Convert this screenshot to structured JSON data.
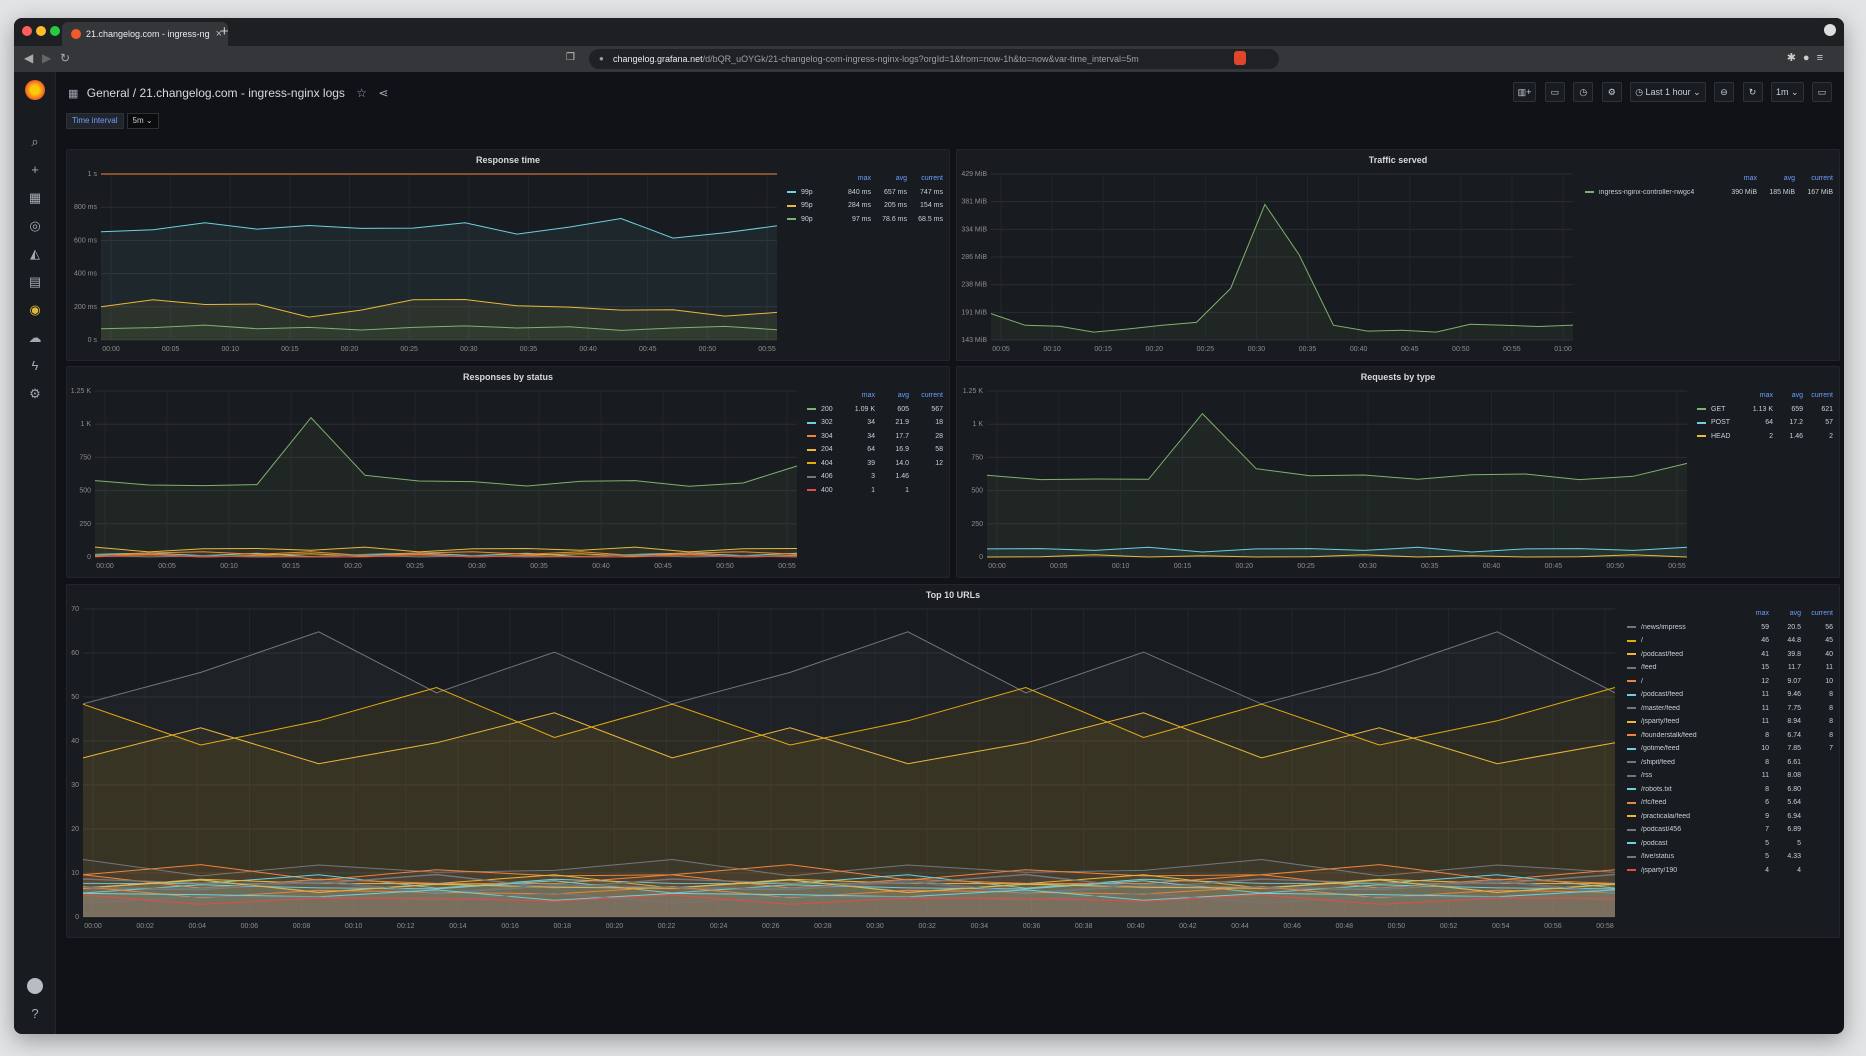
{
  "browser": {
    "tab_title": "21.changelog.com - ingress-ng",
    "url_host": "changelog.grafana.net",
    "url_path": "/d/bQR_uOYGk/21-changelog-com-ingress-nginx-logs?orgId=1&from=now-1h&to=now&var-time_interval=5m"
  },
  "header": {
    "folder": "General",
    "separator": "/",
    "dashboard_title": "21.changelog.com - ingress-nginx logs",
    "time_range": "Last 1 hour",
    "refresh": "1m"
  },
  "variables": {
    "label": "Time interval",
    "value": "5m"
  },
  "colors": {
    "green": "#7eb26d",
    "yellow": "#eab839",
    "blue": "#6ed0e0",
    "orange": "#ef843c",
    "red": "#e24d42",
    "gray": "#73777d",
    "sand": "#e5ac0e"
  },
  "legend_headers": {
    "max": "max",
    "avg": "avg",
    "current": "current"
  },
  "panels": {
    "response_time": {
      "title": "Response time",
      "chart_data": {
        "type": "line",
        "x": [
          "00:00",
          "00:05",
          "00:10",
          "00:15",
          "00:20",
          "00:25",
          "00:30",
          "00:35",
          "00:40",
          "00:45",
          "00:50",
          "00:55"
        ],
        "y_ticks": [
          "0 s",
          "200 ms",
          "400 ms",
          "600 ms",
          "800 ms",
          "1 s"
        ],
        "ylim": [
          0,
          1000
        ],
        "threshold": 1000,
        "series": [
          {
            "name": "99p",
            "color": "blue",
            "max": "840 ms",
            "avg": "657 ms",
            "current": "747 ms",
            "values": [
              640,
              670,
              700,
              680,
              690,
              660,
              680,
              700,
              650,
              680,
              720,
              620,
              640,
              700
            ]
          },
          {
            "name": "95p",
            "color": "yellow",
            "max": "284 ms",
            "avg": "205 ms",
            "current": "154 ms",
            "values": [
              200,
              230,
              220,
              210,
              150,
              180,
              230,
              250,
              200,
              210,
              180,
              170,
              150,
              160
            ]
          },
          {
            "name": "90p",
            "color": "green",
            "max": "97 ms",
            "avg": "78.6 ms",
            "current": "68.5 ms",
            "values": [
              80,
              75,
              78,
              74,
              70,
              72,
              76,
              73,
              78,
              74,
              70,
              72,
              70,
              68
            ]
          }
        ]
      }
    },
    "traffic_served": {
      "title": "Traffic served",
      "chart_data": {
        "type": "line",
        "x": [
          "00:05",
          "00:10",
          "00:15",
          "00:20",
          "00:25",
          "00:30",
          "00:35",
          "00:40",
          "00:45",
          "00:50",
          "00:55",
          "01:00"
        ],
        "y_ticks": [
          "143 MiB",
          "191 MiB",
          "238 MiB",
          "286 MiB",
          "334 MiB",
          "381 MiB",
          "429 MiB"
        ],
        "ylim": [
          143,
          429
        ],
        "series": [
          {
            "name": "ingress-nginx-controller-nwgc4",
            "color": "green",
            "max": "390 MiB",
            "avg": "185 MiB",
            "current": "167 MiB",
            "values": [
              185,
              170,
              165,
              160,
              162,
              165,
              175,
              230,
              380,
              290,
              165,
              160,
              158,
              160,
              170,
              165,
              168,
              167
            ]
          }
        ]
      }
    },
    "responses_by_status": {
      "title": "Responses by status",
      "chart_data": {
        "type": "line",
        "x": [
          "00:00",
          "00:05",
          "00:10",
          "00:15",
          "00:20",
          "00:25",
          "00:30",
          "00:35",
          "00:40",
          "00:45",
          "00:50",
          "00:55"
        ],
        "y_ticks": [
          "0",
          "250",
          "500",
          "750",
          "1 K",
          "1.25 K"
        ],
        "ylim": [
          0,
          1250
        ],
        "series": [
          {
            "name": "200",
            "color": "green",
            "max": "1.09 K",
            "avg": "605",
            "current": "567",
            "values": [
              560,
              550,
              530,
              560,
              1050,
              600,
              580,
              560,
              550,
              570,
              560,
              540,
              550,
              700
            ]
          },
          {
            "name": "302",
            "color": "blue",
            "max": "34",
            "avg": "21.9",
            "current": "18"
          },
          {
            "name": "304",
            "color": "orange",
            "max": "34",
            "avg": "17.7",
            "current": "28"
          },
          {
            "name": "204",
            "color": "yellow",
            "max": "64",
            "avg": "16.9",
            "current": "58"
          },
          {
            "name": "404",
            "color": "sand",
            "max": "39",
            "avg": "14.0",
            "current": "12"
          },
          {
            "name": "406",
            "color": "gray",
            "max": "3",
            "avg": "1.46",
            "current": ""
          },
          {
            "name": "400",
            "color": "red",
            "max": "1",
            "avg": "1",
            "current": ""
          }
        ]
      }
    },
    "requests_by_type": {
      "title": "Requests by type",
      "chart_data": {
        "type": "line",
        "x": [
          "00:00",
          "00:05",
          "00:10",
          "00:15",
          "00:20",
          "00:25",
          "00:30",
          "00:35",
          "00:40",
          "00:45",
          "00:50",
          "00:55"
        ],
        "y_ticks": [
          "0",
          "250",
          "500",
          "750",
          "1 K",
          "1.25 K"
        ],
        "ylim": [
          0,
          1250
        ],
        "series": [
          {
            "name": "GET",
            "color": "green",
            "max": "1.13 K",
            "avg": "659",
            "current": "621",
            "values": [
              600,
              590,
              580,
              600,
              1080,
              650,
              620,
              610,
              600,
              620,
              610,
              590,
              600,
              720
            ]
          },
          {
            "name": "POST",
            "color": "blue",
            "max": "64",
            "avg": "17.2",
            "current": "57"
          },
          {
            "name": "HEAD",
            "color": "yellow",
            "max": "2",
            "avg": "1.46",
            "current": "2"
          }
        ]
      }
    },
    "top_urls": {
      "title": "Top 10 URLs",
      "chart_data": {
        "type": "line",
        "x": [
          "00:00",
          "00:02",
          "00:04",
          "00:06",
          "00:08",
          "00:10",
          "00:12",
          "00:14",
          "00:16",
          "00:18",
          "00:20",
          "00:22",
          "00:24",
          "00:26",
          "00:28",
          "00:30",
          "00:32",
          "00:34",
          "00:36",
          "00:38",
          "00:40",
          "00:42",
          "00:44",
          "00:46",
          "00:48",
          "00:50",
          "00:52",
          "00:54",
          "00:56",
          "00:58"
        ],
        "y_ticks": [
          "0",
          "10",
          "20",
          "30",
          "40",
          "50",
          "60",
          "70"
        ],
        "ylim": [
          0,
          70
        ],
        "series": [
          {
            "name": "/news/impress",
            "color": "gray",
            "max": "59",
            "avg": "20.5",
            "current": "56"
          },
          {
            "name": "/",
            "color": "sand",
            "max": "46",
            "avg": "44.8",
            "current": "45"
          },
          {
            "name": "/podcast/feed",
            "color": "yellow",
            "max": "41",
            "avg": "39.8",
            "current": "40"
          },
          {
            "name": "/feed",
            "color": "gray",
            "max": "15",
            "avg": "11.7",
            "current": "11"
          },
          {
            "name": "/",
            "color": "orange",
            "max": "12",
            "avg": "9.07",
            "current": "10"
          },
          {
            "name": "/podcast/feed",
            "color": "blue",
            "max": "11",
            "avg": "9.46",
            "current": "8"
          },
          {
            "name": "/master/feed",
            "color": "gray",
            "max": "11",
            "avg": "7.75",
            "current": "8"
          },
          {
            "name": "/jsparty/feed",
            "color": "yellow",
            "max": "11",
            "avg": "8.94",
            "current": "8"
          },
          {
            "name": "/founderstalk/feed",
            "color": "orange",
            "max": "8",
            "avg": "6.74",
            "current": "8"
          },
          {
            "name": "/gotime/feed",
            "color": "blue",
            "max": "10",
            "avg": "7.85",
            "current": "7"
          },
          {
            "name": "/shipit/feed",
            "color": "gray",
            "max": "8",
            "avg": "6.61",
            "current": ""
          },
          {
            "name": "/rss",
            "color": "gray",
            "max": "11",
            "avg": "8.08",
            "current": ""
          },
          {
            "name": "/robots.txt",
            "color": "blue",
            "max": "8",
            "avg": "6.80",
            "current": ""
          },
          {
            "name": "/rfc/feed",
            "color": "orange",
            "max": "6",
            "avg": "5.64",
            "current": ""
          },
          {
            "name": "/practicalai/feed",
            "color": "yellow",
            "max": "9",
            "avg": "6.94",
            "current": ""
          },
          {
            "name": "/podcast/456",
            "color": "gray",
            "max": "7",
            "avg": "6.89",
            "current": ""
          },
          {
            "name": "/podcast",
            "color": "blue",
            "max": "5",
            "avg": "5",
            "current": ""
          },
          {
            "name": "/live/status",
            "color": "gray",
            "max": "5",
            "avg": "4.33",
            "current": ""
          },
          {
            "name": "/jsparty/190",
            "color": "red",
            "max": "4",
            "avg": "4",
            "current": ""
          }
        ]
      }
    }
  }
}
